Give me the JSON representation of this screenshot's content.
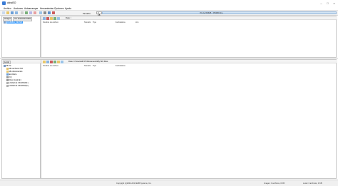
{
  "window": {
    "title": "ultraISO"
  },
  "menu": [
    "Archivo",
    "Acciones",
    "Autoarranque",
    "Herramientas",
    "Opciones",
    "Ayuda"
  ],
  "toolbar": {
    "size_label": "Tamaño:",
    "size_value": "0 KB",
    "capacity_text": "0% de 650MB · 650MB libre"
  },
  "top_left": {
    "tabs": [
      "Imagen",
      "No autoarrancable"
    ],
    "root_item": "20180411_094726"
  },
  "top_right": {
    "path_label": "Ruta:",
    "path_value": "/",
    "columns": [
      "Nombre de archivo",
      "Tamaño",
      "Tipo",
      "Fecha/Hora",
      "Lbn"
    ]
  },
  "bottom_left": {
    "tab": "Local",
    "tree": [
      "Mi PC",
      "Mis archivos ISO",
      "Mis documentos",
      "Escritorio",
      "(C:)",
      "Disco local (E:)",
      "Unidad de CD-ROM(F:)",
      "Unidad de CD-ROM(G:)"
    ]
  },
  "bottom_right": {
    "path_label": "Ruta:",
    "path_value": "C:\\Users\\HP-PC\\Documents\\My ISO Files",
    "columns": [
      "Nombre de archivo",
      "Tamaño",
      "Tipo",
      "Fecha/Hora"
    ]
  },
  "status": {
    "copyright": "Copyright (c)2002-2016 EZB Systems, Inc.",
    "image_info": "Imagen: 0 archivos, 0 KB",
    "local_info": "Local: 0 archivos, 0 KB"
  },
  "colors": {
    "accent": "#3399ff",
    "capacity_bar": "#b7d3ee"
  }
}
